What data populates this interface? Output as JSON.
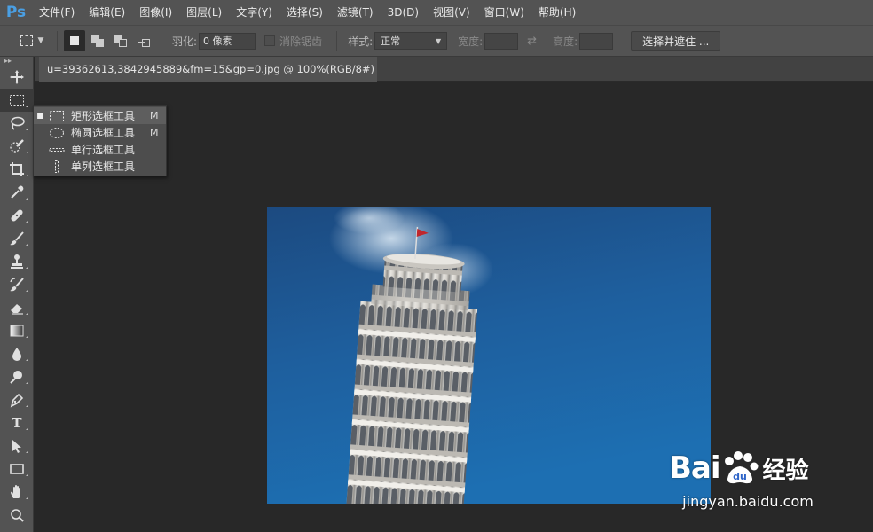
{
  "app": {
    "logo": "Ps"
  },
  "menu": [
    "文件(F)",
    "编辑(E)",
    "图像(I)",
    "图层(L)",
    "文字(Y)",
    "选择(S)",
    "滤镜(T)",
    "3D(D)",
    "视图(V)",
    "窗口(W)",
    "帮助(H)"
  ],
  "options": {
    "feather_label": "羽化:",
    "feather_value": "0 像素",
    "antialias_label": "消除锯齿",
    "style_label": "样式:",
    "style_value": "正常",
    "width_label": "宽度:",
    "height_label": "高度:",
    "select_mask_button": "选择并遮住 ..."
  },
  "document": {
    "tab_title": "u=39362613,3842945889&fm=15&gp=0.jpg @ 100%(RGB/8#)",
    "close_glyph": "✕"
  },
  "tools": [
    "move-tool",
    "rectangular-marquee-tool",
    "lasso-tool",
    "quick-selection-tool",
    "crop-tool",
    "eyedropper-tool",
    "healing-brush-tool",
    "brush-tool",
    "clone-stamp-tool",
    "history-brush-tool",
    "eraser-tool",
    "gradient-tool",
    "blur-tool",
    "dodge-tool",
    "pen-tool",
    "type-tool",
    "path-selection-tool",
    "rectangle-tool",
    "hand-tool",
    "zoom-tool"
  ],
  "type_tool_glyph": "T",
  "flyout": {
    "items": [
      {
        "label": "矩形选框工具",
        "key": "M",
        "active": true,
        "bullet": "■"
      },
      {
        "label": "椭圆选框工具",
        "key": "M",
        "active": false,
        "bullet": ""
      },
      {
        "label": "单行选框工具",
        "key": "",
        "active": false,
        "bullet": ""
      },
      {
        "label": "单列选框工具",
        "key": "",
        "active": false,
        "bullet": ""
      }
    ]
  },
  "watermark": {
    "brand_bai": "Bai",
    "brand_du": "du",
    "brand_jy": "经验",
    "url": "jingyan.baidu.com"
  },
  "colors": {
    "ps_blue": "#4a9fe3",
    "sky_top": "#1f4f86",
    "sky_bottom": "#1d6eb0"
  }
}
